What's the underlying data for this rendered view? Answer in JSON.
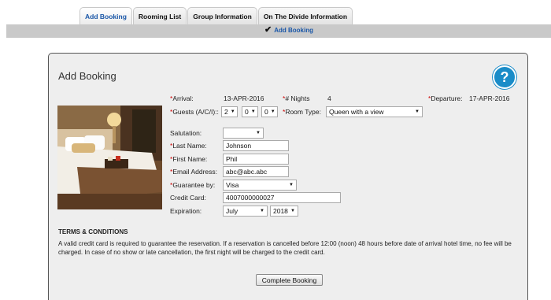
{
  "tabs": [
    {
      "label": "Add Booking",
      "active": true
    },
    {
      "label": "Rooming List",
      "active": false
    },
    {
      "label": "Group Information",
      "active": false
    },
    {
      "label": "On The Divide Information",
      "active": false
    }
  ],
  "subnav": {
    "label": "Add Booking",
    "icon": "checkmark-icon"
  },
  "panel": {
    "title": "Add Booking",
    "help_label": "?",
    "arrival_label": "Arrival:",
    "arrival_value": "13-APR-2016",
    "nights_label": "# Nights",
    "nights_value": "4",
    "departure_label": "Departure:",
    "departure_value": "17-APR-2016",
    "guests_label": "Guests (A/C/I)::",
    "guests_adults": "2",
    "guests_children": "0",
    "guests_infants": "0",
    "room_type_label": "Room Type:",
    "room_type_value": "Queen with a view",
    "salutation_label": "Salutation:",
    "salutation_value": "",
    "last_name_label": "Last Name:",
    "last_name_value": "Johnson",
    "first_name_label": "First Name:",
    "first_name_value": "Phil",
    "email_label": "Email Address:",
    "email_value": "abc@abc.abc",
    "guarantee_label": "Guarantee by:",
    "guarantee_value": "Visa",
    "card_label": "Credit Card:",
    "card_value": "4007000000027",
    "expiration_label": "Expiration:",
    "exp_month": "July",
    "exp_year": "2018",
    "required_mark": "*"
  },
  "terms": {
    "title": "TERMS & CONDITIONS",
    "text": "A valid credit card is required to guarantee the reservation. If a reservation is cancelled before 12:00 (noon) 48 hours before date of arrival hotel time, no fee will be charged. In case of no show or late cancellation, the first night will be charged to the credit card."
  },
  "submit_label": "Complete Booking",
  "colors": {
    "accent": "#1a57a8",
    "help": "#1a8cc8",
    "required": "#cc0000"
  }
}
